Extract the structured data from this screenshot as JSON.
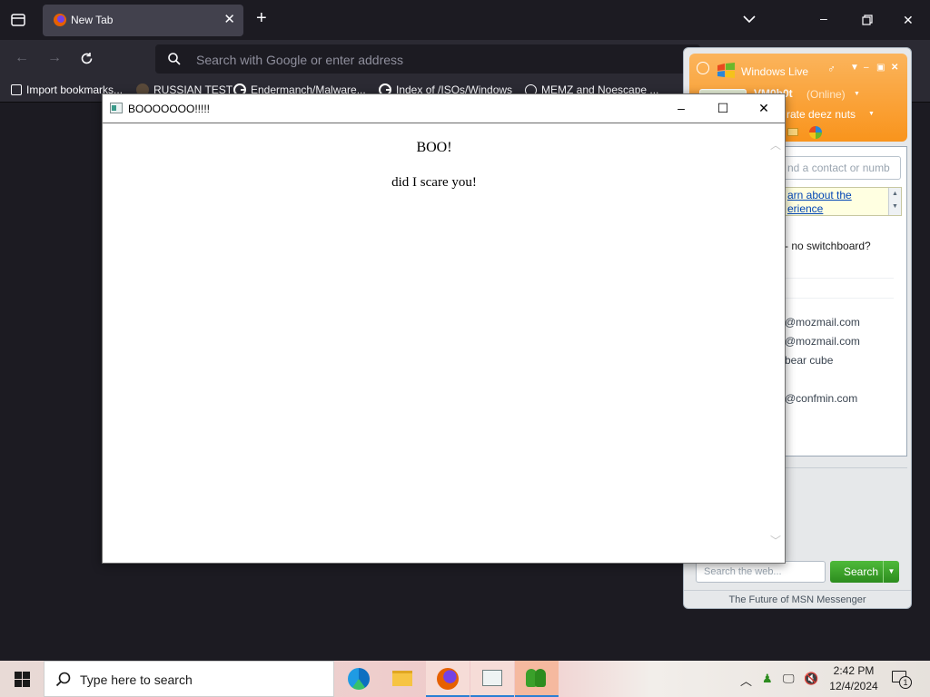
{
  "browser": {
    "tab_title": "New Tab",
    "url_placeholder": "Search with Google or enter address",
    "bookmarks": [
      "Import bookmarks...",
      "RUSSIAN TEST",
      "Endermanch/Malware...",
      "Index of /ISOs/Windows",
      "MEMZ and Noescape ..."
    ]
  },
  "messenger": {
    "brand": "Windows Live",
    "display_name": "VM0b0t",
    "status": "(Online)",
    "personal_message": "rate deez nuts",
    "find_placeholder": "nd a contact or numb",
    "info_link_1": "arn about the",
    "info_link_2": "erience",
    "contacts": [
      "- no switchboard?",
      "@mozmail.com",
      "@mozmail.com",
      "bear cube",
      "@confmin.com"
    ],
    "web_placeholder": "Search the web...",
    "search_label": "Search",
    "footer": "The Future of MSN Messenger"
  },
  "popup": {
    "title": "BOOOOOOO!!!!!",
    "heading": "BOO!",
    "message": "did I scare you!"
  },
  "taskbar": {
    "search_placeholder": "Type here to search",
    "time": "2:42 PM",
    "date": "12/4/2024",
    "notification_count": "1"
  },
  "colors": {
    "browser_bg": "#1c1b22",
    "toolbar_bg": "#2b2a33",
    "msn_orange": "#f9941c",
    "msn_green": "#3aa02a",
    "taskbar_accent": "#2a7fd4"
  }
}
